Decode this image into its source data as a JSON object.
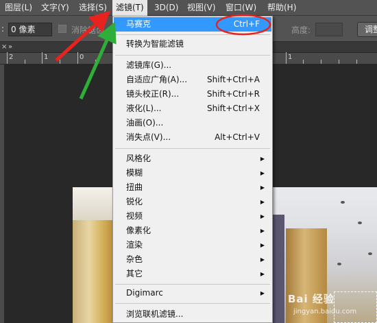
{
  "menubar": {
    "items": [
      {
        "label": "图层(L)"
      },
      {
        "label": "文字(Y)"
      },
      {
        "label": "选择(S)"
      },
      {
        "label": "滤镜(T)"
      },
      {
        "label": "3D(D)"
      },
      {
        "label": "视图(V)"
      },
      {
        "label": "窗口(W)"
      },
      {
        "label": "帮助(H)"
      }
    ]
  },
  "options_bar": {
    "feather_value": "0 像素",
    "antialias_label": "消除锯齿",
    "height_label": "高度:",
    "adjust_label": "调整"
  },
  "tab": {
    "close_glyph": "×",
    "overflow_glyph": "»"
  },
  "ruler": {
    "labels": [
      "2",
      "1",
      "0",
      "1"
    ]
  },
  "filter_menu": {
    "items": [
      {
        "label": "马赛克",
        "shortcut": "Ctrl+F",
        "highlighted": true
      },
      {
        "label": "转换为智能滤镜",
        "shortcut": ""
      },
      {
        "label": "滤镜库(G)...",
        "shortcut": ""
      },
      {
        "label": "自适应广角(A)...",
        "shortcut": "Shift+Ctrl+A"
      },
      {
        "label": "镜头校正(R)...",
        "shortcut": "Shift+Ctrl+R"
      },
      {
        "label": "液化(L)...",
        "shortcut": "Shift+Ctrl+X"
      },
      {
        "label": "油画(O)...",
        "shortcut": ""
      },
      {
        "label": "消失点(V)...",
        "shortcut": "Alt+Ctrl+V"
      },
      {
        "label": "风格化",
        "submenu": true
      },
      {
        "label": "模糊",
        "submenu": true
      },
      {
        "label": "扭曲",
        "submenu": true
      },
      {
        "label": "锐化",
        "submenu": true
      },
      {
        "label": "视频",
        "submenu": true
      },
      {
        "label": "像素化",
        "submenu": true
      },
      {
        "label": "渲染",
        "submenu": true
      },
      {
        "label": "杂色",
        "submenu": true
      },
      {
        "label": "其它",
        "submenu": true
      },
      {
        "label": "Digimarc",
        "submenu": true
      },
      {
        "label": "浏览联机滤镜..."
      }
    ],
    "submenu_arrow": "▶"
  },
  "watermark": {
    "text": "Bai 经验",
    "sub": "jingyan.baidu.com"
  },
  "colors": {
    "highlight": "#3399ff",
    "annotation_red": "#e8231f",
    "annotation_green": "#2fae3a",
    "menubar_bg": "#535353"
  }
}
